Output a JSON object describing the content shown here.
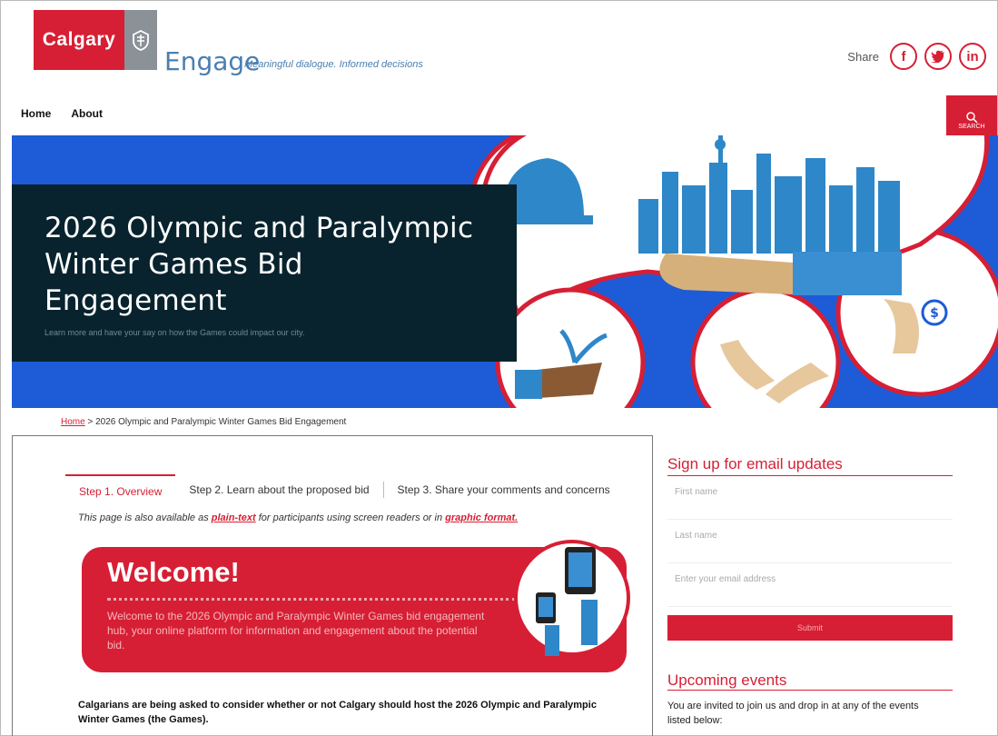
{
  "header": {
    "logo_text": "Calgary",
    "brand": "Engage",
    "tagline": "Meaningful dialogue. Informed decisions",
    "share_label": "Share",
    "social": [
      "f",
      "t",
      "in"
    ]
  },
  "nav": {
    "items": [
      "Home",
      "About"
    ],
    "search_label": "SEARCH"
  },
  "hero": {
    "title": "2026 Olympic and Paralympic Winter Games Bid Engagement",
    "subtitle": "Learn more and have your say on how the Games could impact our city."
  },
  "breadcrumb": {
    "home": "Home",
    "separator": ">",
    "current": "2026 Olympic and Paralympic Winter Games Bid Engagement"
  },
  "tabs": [
    "Step 1. Overview",
    "Step 2. Learn about the proposed bid",
    "Step 3. Share your comments and concerns"
  ],
  "availability": {
    "prefix": "This page is also available as ",
    "link1": "plain-text",
    "middle": " for participants using screen readers or in ",
    "link2": "graphic format."
  },
  "welcome": {
    "title": "Welcome!",
    "text": "Welcome to the 2026 Olympic and Paralympic Winter Games bid engagement hub, your online platform for information and engagement about the potential bid."
  },
  "intro": "Calgarians are being asked to consider whether or not Calgary should host the 2026 Olympic and Paralympic Winter Games (the Games).",
  "signup": {
    "heading": "Sign up for email updates",
    "first_name_placeholder": "First name",
    "last_name_placeholder": "Last name",
    "email_placeholder": "Enter your email address",
    "submit": "Submit"
  },
  "events": {
    "heading": "Upcoming events",
    "text": "You are invited to join us and drop in at any of the events listed below:"
  },
  "colors": {
    "accent": "#d61f34",
    "hero_blue": "#1e5bd6",
    "hero_box": "#08232d"
  }
}
